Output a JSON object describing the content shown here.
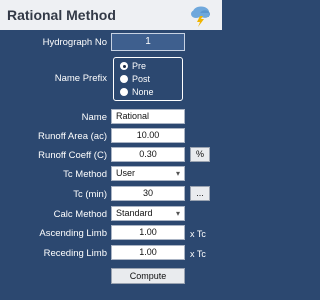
{
  "header": {
    "title": "Rational Method"
  },
  "icons": {
    "cloud": "cloud-lightning-icon",
    "accent": "#2c4870"
  },
  "form": {
    "hydrograph_no": {
      "label": "Hydrograph No",
      "value": "1"
    },
    "name_prefix": {
      "label": "Name Prefix",
      "options": [
        "Pre",
        "Post",
        "None"
      ],
      "selected": "Pre"
    },
    "name": {
      "label": "Name",
      "value": "Rational"
    },
    "runoff_area": {
      "label": "Runoff Area (ac)",
      "value": "10.00"
    },
    "runoff_coeff": {
      "label": "Runoff Coeff (C)",
      "value": "0.30",
      "button": "%"
    },
    "tc_method": {
      "label": "Tc Method",
      "value": "User"
    },
    "tc": {
      "label": "Tc (min)",
      "value": "30",
      "button": "..."
    },
    "calc_method": {
      "label": "Calc Method",
      "value": "Standard"
    },
    "ascending_limb": {
      "label": "Ascending Limb",
      "value": "1.00",
      "unit": "x Tc"
    },
    "receding_limb": {
      "label": "Receding Limb",
      "value": "1.00",
      "unit": "x Tc"
    }
  },
  "actions": {
    "compute": "Compute"
  }
}
